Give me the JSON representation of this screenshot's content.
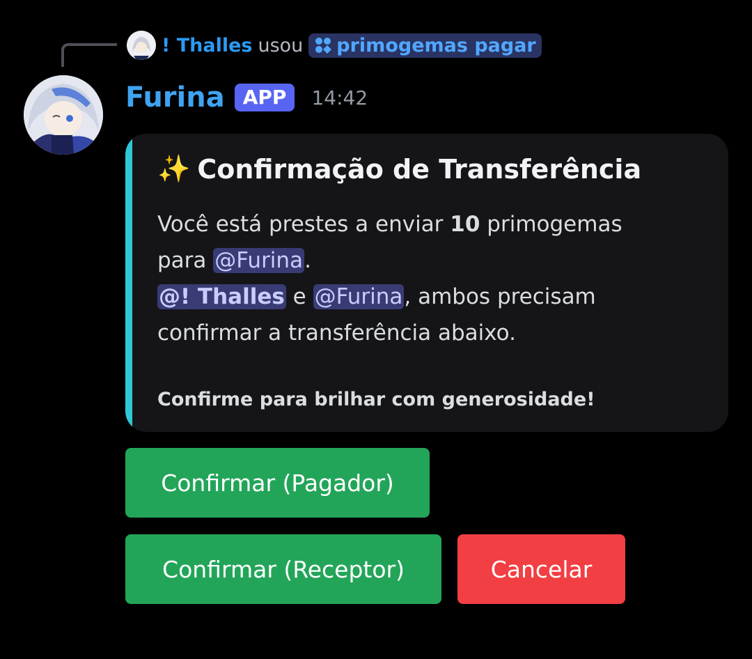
{
  "reply": {
    "user": "! Thalles",
    "action": "usou",
    "command": "primogemas pagar"
  },
  "message": {
    "author": "Furina",
    "badge": "APP",
    "time": "14:42"
  },
  "embed": {
    "emoji": "✨",
    "title": "Confirmação de Transferência",
    "line1_prefix": "Você está prestes a enviar",
    "amount": "10",
    "line1_suffix": "primogemas",
    "line2_prefix": "para",
    "mention_receiver": "@Furina",
    "line2_suffix": ".",
    "mention_payer": "@! Thalles",
    "conj": "e",
    "mention_receiver2": "@Furina",
    "line3_suffix": ", ambos precisam confirmar a transferência abaixo.",
    "footer": "Confirme para brilhar com generosidade!",
    "accent_color": "#2fc8d6"
  },
  "buttons": {
    "confirm_payer": "Confirmar (Pagador)",
    "confirm_receiver": "Confirmar (Receptor)",
    "cancel": "Cancelar"
  },
  "colors": {
    "success": "#23a559",
    "danger": "#f23f43",
    "app_badge": "#5865f2"
  }
}
